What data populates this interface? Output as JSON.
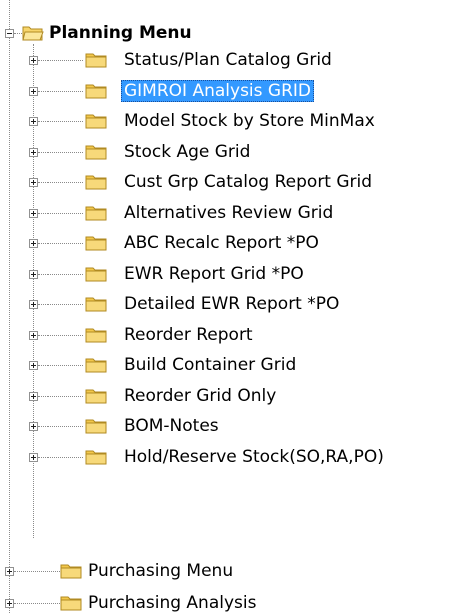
{
  "tree": {
    "root": {
      "label": "Planning Menu",
      "expanded": true,
      "icon": "open-folder-icon"
    },
    "children": [
      {
        "label": "Status/Plan Catalog Grid"
      },
      {
        "label": "GIMROI Analysis GRID",
        "selected": true
      },
      {
        "label": "Model Stock by Store MinMax"
      },
      {
        "label": "Stock Age Grid"
      },
      {
        "label": "Cust Grp Catalog Report Grid"
      },
      {
        "label": "Alternatives Review Grid"
      },
      {
        "label": "ABC Recalc Report *PO"
      },
      {
        "label": "EWR Report Grid *PO"
      },
      {
        "label": "Detailed EWR Report *PO"
      },
      {
        "label": "Reorder Report"
      },
      {
        "label": "Build Container Grid"
      },
      {
        "label": "Reorder Grid Only"
      },
      {
        "label": "BOM-Notes"
      },
      {
        "label": "Hold/Reserve Stock(SO,RA,PO)"
      }
    ],
    "siblings": [
      {
        "label": "Purchasing Menu"
      },
      {
        "label": "Purchasing Analysis"
      }
    ]
  },
  "colors": {
    "selection": "#3399ff",
    "folder_fill": "#f7d56b",
    "folder_stroke": "#b08a22",
    "tree_line": "#8a8a8a"
  }
}
